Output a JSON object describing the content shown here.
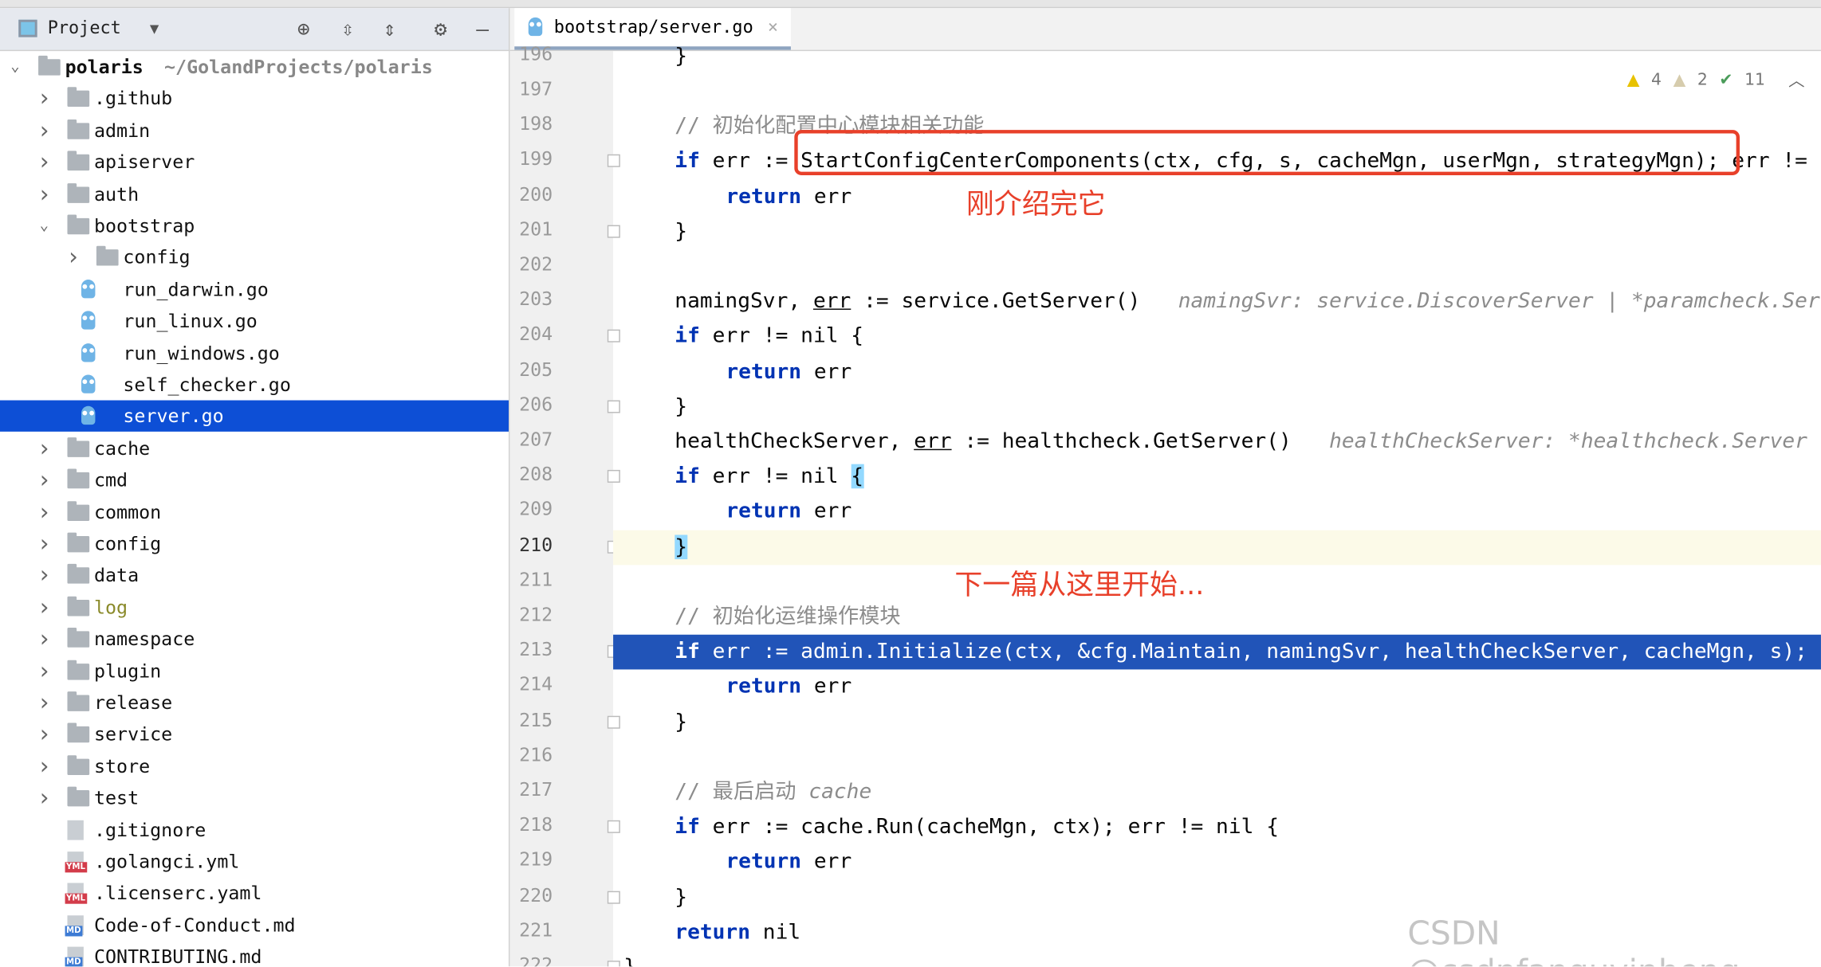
{
  "sidebar": {
    "title": "Project",
    "icons": [
      "locate-icon",
      "expand-all-icon",
      "collapse-all-icon",
      "gear-icon",
      "minimize-icon"
    ],
    "tree": [
      {
        "label": "polaris",
        "path": "~/GolandProjects/polaris",
        "level": 0,
        "type": "folder",
        "open": true,
        "bold": true
      },
      {
        "label": ".github",
        "level": 1,
        "type": "folder"
      },
      {
        "label": "admin",
        "level": 1,
        "type": "folder"
      },
      {
        "label": "apiserver",
        "level": 1,
        "type": "folder"
      },
      {
        "label": "auth",
        "level": 1,
        "type": "folder"
      },
      {
        "label": "bootstrap",
        "level": 1,
        "type": "folder",
        "open": true
      },
      {
        "label": "config",
        "level": 2,
        "type": "folder"
      },
      {
        "label": "run_darwin.go",
        "level": 2,
        "type": "go"
      },
      {
        "label": "run_linux.go",
        "level": 2,
        "type": "go"
      },
      {
        "label": "run_windows.go",
        "level": 2,
        "type": "go"
      },
      {
        "label": "self_checker.go",
        "level": 2,
        "type": "go"
      },
      {
        "label": "server.go",
        "level": 2,
        "type": "go",
        "selected": true
      },
      {
        "label": "cache",
        "level": 1,
        "type": "folder"
      },
      {
        "label": "cmd",
        "level": 1,
        "type": "folder"
      },
      {
        "label": "common",
        "level": 1,
        "type": "folder"
      },
      {
        "label": "config",
        "level": 1,
        "type": "folder"
      },
      {
        "label": "data",
        "level": 1,
        "type": "folder"
      },
      {
        "label": "log",
        "level": 1,
        "type": "folder",
        "color": "#8a8a2a"
      },
      {
        "label": "namespace",
        "level": 1,
        "type": "folder"
      },
      {
        "label": "plugin",
        "level": 1,
        "type": "folder"
      },
      {
        "label": "release",
        "level": 1,
        "type": "folder"
      },
      {
        "label": "service",
        "level": 1,
        "type": "folder"
      },
      {
        "label": "store",
        "level": 1,
        "type": "folder"
      },
      {
        "label": "test",
        "level": 1,
        "type": "folder"
      },
      {
        "label": ".gitignore",
        "level": 1,
        "type": "file",
        "badge": ""
      },
      {
        "label": ".golangci.yml",
        "level": 1,
        "type": "file",
        "badge": "YML"
      },
      {
        "label": ".licenserc.yaml",
        "level": 1,
        "type": "file",
        "badge": "YML"
      },
      {
        "label": "Code-of-Conduct.md",
        "level": 1,
        "type": "file",
        "badge": "MD"
      },
      {
        "label": "CONTRIBUTING.md",
        "level": 1,
        "type": "file",
        "badge": "MD"
      }
    ]
  },
  "editor": {
    "tab_label": "bootstrap/server.go",
    "inspections": {
      "warnings": "4",
      "weak_warnings": "2",
      "typos": "11"
    },
    "lines": [
      {
        "n": "196",
        "indent": 1,
        "seg": [
          [
            "}",
            ""
          ]
        ]
      },
      {
        "n": "197",
        "indent": 0,
        "seg": []
      },
      {
        "n": "198",
        "indent": 1,
        "seg": [
          [
            "// 初始化配置中心模块相关功能",
            "cm"
          ]
        ]
      },
      {
        "n": "199",
        "indent": 1,
        "fold": true,
        "seg": [
          [
            "if",
            "kw"
          ],
          [
            " err := StartConfigCenterComponents(ctx, cfg, s, cacheMgn, userMgn, strategyMgn); err != nil {",
            ""
          ]
        ]
      },
      {
        "n": "200",
        "indent": 2,
        "seg": [
          [
            "return",
            "kw"
          ],
          [
            " err",
            ""
          ]
        ]
      },
      {
        "n": "201",
        "indent": 1,
        "fold": true,
        "seg": [
          [
            "}",
            ""
          ]
        ]
      },
      {
        "n": "202",
        "indent": 0,
        "seg": []
      },
      {
        "n": "203",
        "indent": 1,
        "seg": [
          [
            "namingSvr, ",
            ""
          ],
          [
            "err",
            "ul"
          ],
          [
            " := service.GetServer()",
            ""
          ],
          [
            "   namingSvr: service.DiscoverServer | *paramcheck.Server",
            "hint"
          ]
        ]
      },
      {
        "n": "204",
        "indent": 1,
        "fold": true,
        "seg": [
          [
            "if",
            "kw"
          ],
          [
            " err != nil {",
            ""
          ]
        ]
      },
      {
        "n": "205",
        "indent": 2,
        "seg": [
          [
            "return",
            "kw"
          ],
          [
            " err",
            ""
          ]
        ]
      },
      {
        "n": "206",
        "indent": 1,
        "fold": true,
        "seg": [
          [
            "}",
            ""
          ]
        ]
      },
      {
        "n": "207",
        "indent": 1,
        "seg": [
          [
            "healthCheckServer, ",
            ""
          ],
          [
            "err",
            "ul"
          ],
          [
            " := healthcheck.GetServer()",
            ""
          ],
          [
            "   healthCheckServer: *healthcheck.Server",
            "hint"
          ]
        ]
      },
      {
        "n": "208",
        "indent": 1,
        "fold": true,
        "seg": [
          [
            "if",
            "kw"
          ],
          [
            " err != nil ",
            ""
          ],
          [
            "{",
            "brace"
          ]
        ]
      },
      {
        "n": "209",
        "indent": 2,
        "seg": [
          [
            "return",
            "kw"
          ],
          [
            " err",
            ""
          ]
        ]
      },
      {
        "n": "210",
        "indent": 1,
        "fold": true,
        "current": true,
        "seg": [
          [
            "}",
            "brace"
          ]
        ]
      },
      {
        "n": "211",
        "indent": 0,
        "seg": []
      },
      {
        "n": "212",
        "indent": 1,
        "seg": [
          [
            "// 初始化运维操作模块",
            "cm"
          ]
        ]
      },
      {
        "n": "213",
        "indent": 1,
        "fold": true,
        "selected": true,
        "seg": [
          [
            "if",
            "kw"
          ],
          [
            " err := admin.Initialize(ctx, &cfg.Maintain, namingSvr, healthCheckServer, cacheMgn, s); err != nil {",
            ""
          ]
        ]
      },
      {
        "n": "214",
        "indent": 2,
        "seg": [
          [
            "return",
            "kw"
          ],
          [
            " err",
            ""
          ]
        ]
      },
      {
        "n": "215",
        "indent": 1,
        "fold": true,
        "seg": [
          [
            "}",
            ""
          ]
        ]
      },
      {
        "n": "216",
        "indent": 0,
        "seg": []
      },
      {
        "n": "217",
        "indent": 1,
        "seg": [
          [
            "// 最后启动 ",
            "cm"
          ],
          [
            "cache",
            "cmi"
          ]
        ]
      },
      {
        "n": "218",
        "indent": 1,
        "fold": true,
        "seg": [
          [
            "if",
            "kw"
          ],
          [
            " err := cache.Run(cacheMgn, ctx); err != nil {",
            ""
          ]
        ]
      },
      {
        "n": "219",
        "indent": 2,
        "seg": [
          [
            "return",
            "kw"
          ],
          [
            " err",
            ""
          ]
        ]
      },
      {
        "n": "220",
        "indent": 1,
        "fold": true,
        "seg": [
          [
            "}",
            ""
          ]
        ]
      },
      {
        "n": "221",
        "indent": 1,
        "seg": [
          [
            "return",
            "kw"
          ],
          [
            " nil",
            ""
          ]
        ]
      },
      {
        "n": "222",
        "indent": 0,
        "fold": true,
        "seg": [
          [
            "}",
            ""
          ]
        ]
      }
    ]
  },
  "annotations": {
    "note1": "刚介绍完它",
    "note2": "下一篇从这里开始...",
    "color": "#e8402a"
  },
  "watermark": "CSDN @csdnfanguyinheng"
}
